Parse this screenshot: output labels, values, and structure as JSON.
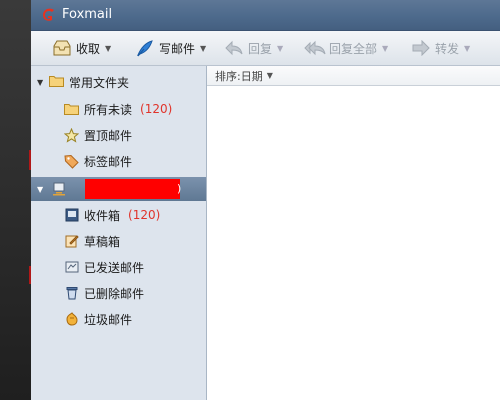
{
  "app": {
    "title": "Foxmail"
  },
  "toolbar": {
    "receive": "收取",
    "compose": "写邮件",
    "reply": "回复",
    "reply_all": "回复全部",
    "forward": "转发"
  },
  "sidebar": {
    "common_folders": {
      "label": "常用文件夹",
      "items": [
        {
          "label": "所有未读",
          "count": "(120)",
          "icon": "folder-icon"
        },
        {
          "label": "置顶邮件",
          "icon": "star-icon"
        },
        {
          "label": "标签邮件",
          "icon": "tag-icon"
        }
      ]
    },
    "account": {
      "tail": ")",
      "items": [
        {
          "label": "收件箱",
          "count": "(120)",
          "icon": "inbox-icon"
        },
        {
          "label": "草稿箱",
          "icon": "drafts-icon"
        },
        {
          "label": "已发送邮件",
          "icon": "sent-icon"
        },
        {
          "label": "已删除邮件",
          "icon": "trash-icon"
        },
        {
          "label": "垃圾邮件",
          "icon": "junk-icon"
        }
      ]
    }
  },
  "main": {
    "sort_label": "排序:日期"
  },
  "colors": {
    "title_bar": "#4d6a8c",
    "sidebar_bg": "#dde4ed",
    "account_bg": "#6a829d",
    "count_red": "#e0342b"
  }
}
